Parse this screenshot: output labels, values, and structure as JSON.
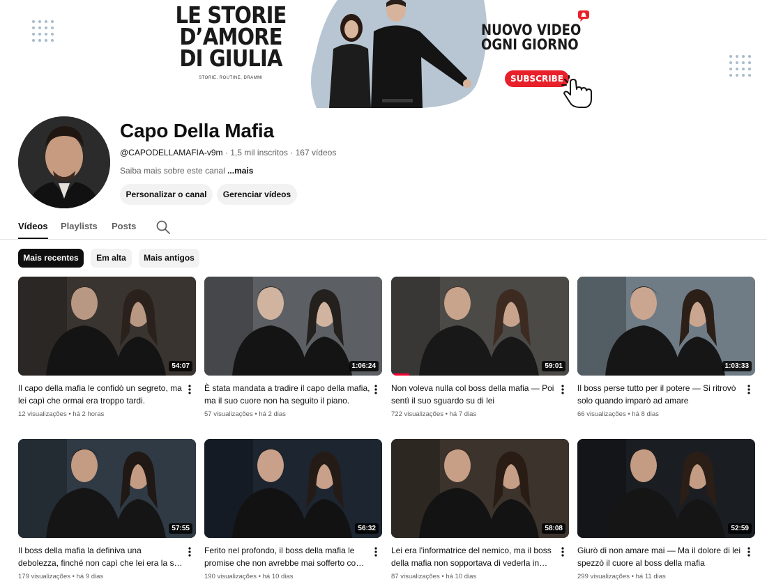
{
  "banner": {
    "title": "LE STORIE D’AMORE DI GIULIA",
    "subtitle": "STORIE, ROUTINE, DRAMMI",
    "tagline_line1": "NUOVO VIDEO",
    "tagline_line2": "OGNI GIORNO",
    "subscribe_label": "SUBSCRIBE"
  },
  "channel": {
    "name": "Capo Della Mafia",
    "handle": "@CAPODELLAMAFIA-v9m",
    "subscribers": "1,5 mil inscritos",
    "video_count": "167 vídeos",
    "separator": "·",
    "about": "Saiba mais sobre este canal ",
    "about_more": "...mais",
    "customize_label": "Personalizar o canal",
    "manage_label": "Gerenciar vídeos"
  },
  "tabs": [
    {
      "label": "Vídeos",
      "active": true
    },
    {
      "label": "Playlists",
      "active": false
    },
    {
      "label": "Posts",
      "active": false
    }
  ],
  "chips": [
    {
      "label": "Mais recentes",
      "active": true
    },
    {
      "label": "Em alta",
      "active": false
    },
    {
      "label": "Mais antigos",
      "active": false
    }
  ],
  "videos": [
    {
      "title": "Il capo della mafia le confidò un segreto, ma lei capì che ormai era troppo tardi.",
      "duration": "54:07",
      "views": "12 visualizações",
      "age": "há 2 horas",
      "progress": 0
    },
    {
      "title": "È stata mandata a tradire il capo della mafia, ma il suo cuore non ha seguito il piano.",
      "duration": "1:06:24",
      "views": "57 visualizações",
      "age": "há 2 dias",
      "progress": 0
    },
    {
      "title": "Non voleva nulla col boss della mafia — Poi sentì il suo sguardo su di lei",
      "duration": "59:01",
      "views": "722 visualizações",
      "age": "há 7 dias",
      "progress": 0.1
    },
    {
      "title": "Il boss perse tutto per il potere — Si ritrovò solo quando imparò ad amare",
      "duration": "1:03:33",
      "views": "66 visualizações",
      "age": "há 8 dias",
      "progress": 0
    },
    {
      "title": "Il boss della mafia la definiva una debolezza, finché non capì che lei era la sua unica forza.",
      "duration": "57:55",
      "views": "179 visualizações",
      "age": "há 9 dias",
      "progress": 0
    },
    {
      "title": "Ferito nel profondo, il boss della mafia le promise che non avrebbe mai sofferto come lei.",
      "duration": "56:32",
      "views": "190 visualizações",
      "age": "há 10 dias",
      "progress": 0
    },
    {
      "title": "Lei era l'informatrice del nemico, ma il boss della mafia non sopportava di vederla in pericolo.",
      "duration": "58:08",
      "views": "87 visualizações",
      "age": "há 10 dias",
      "progress": 0
    },
    {
      "title": "Giurò di non amare mai — Ma il dolore di lei spezzò il cuore al boss della mafia",
      "duration": "52:59",
      "views": "299 visualizações",
      "age": "há 11 dias",
      "progress": 0
    }
  ],
  "icons": {
    "search": "search-icon",
    "menu": "more-vert-icon",
    "bell": "bell-icon",
    "hand": "pointer-hand-icon"
  },
  "colors": {
    "accent": "#ff0033",
    "subscribe": "#e8202a",
    "chip_active": "#0f0f0f",
    "chip": "#f2f2f2",
    "meta_text": "#606060"
  }
}
